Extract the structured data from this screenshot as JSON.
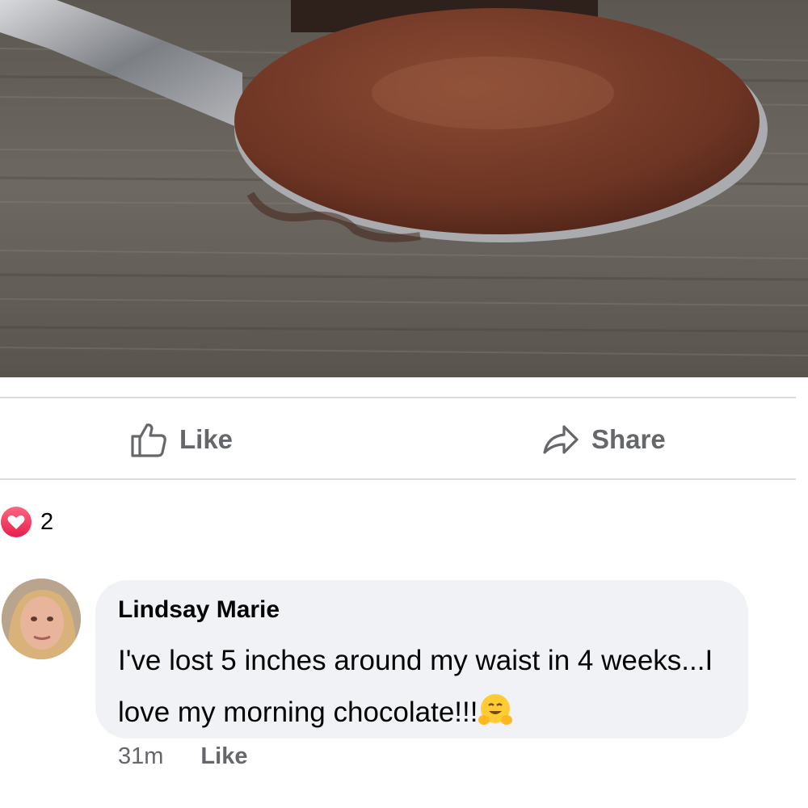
{
  "post": {
    "photo_description_icon": "spoon-with-chocolate-image",
    "actions": {
      "like_label": "Like",
      "share_label": "Share"
    },
    "reactions": {
      "icon": "heart-reaction-icon",
      "count": "2"
    }
  },
  "comment": {
    "author": "Lindsay Marie",
    "text": "I've lost 5 inches around my waist in 4 weeks...I love my morning chocolate!!!",
    "emoji": "hugging-face-emoji",
    "time": "31m",
    "like_label": "Like"
  },
  "colors": {
    "divider": "#dadde1",
    "action_text": "#65676b",
    "bubble": "#f0f2f5",
    "heart_gradient_top": "#ff6680",
    "heart_gradient_bottom": "#e61e4d"
  }
}
